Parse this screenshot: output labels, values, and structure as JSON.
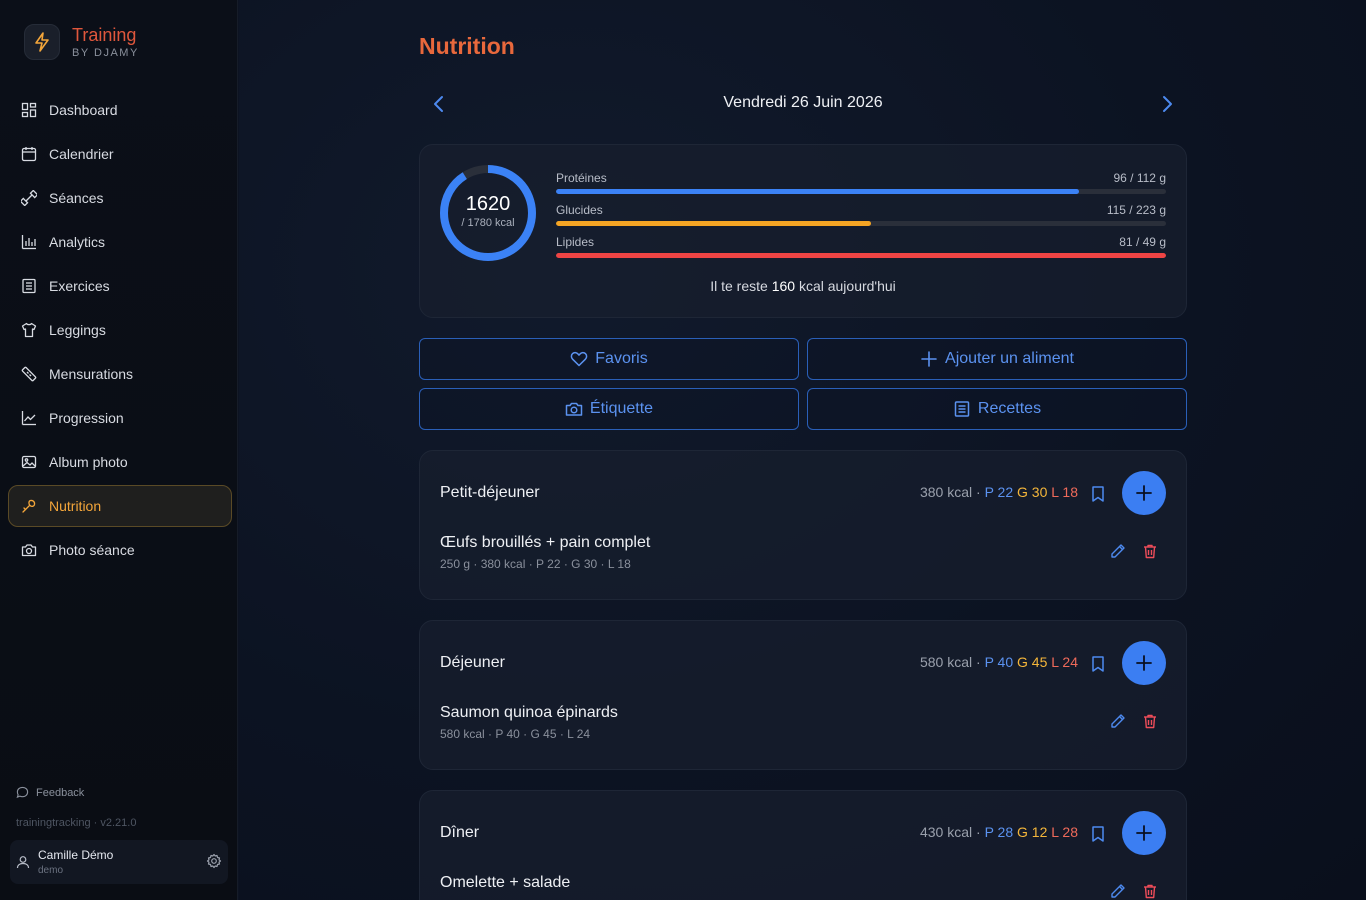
{
  "brand": {
    "title": "Training",
    "subtitle": "BY DJAMY",
    "logo_icon": "bolt-icon"
  },
  "sidebar": {
    "items": [
      {
        "label": "Dashboard",
        "icon": "dashboard-icon"
      },
      {
        "label": "Calendrier",
        "icon": "calendar-icon"
      },
      {
        "label": "Séances",
        "icon": "dumbbell-icon"
      },
      {
        "label": "Analytics",
        "icon": "bar-chart-icon"
      },
      {
        "label": "Exercices",
        "icon": "list-icon"
      },
      {
        "label": "Leggings",
        "icon": "shirt-icon"
      },
      {
        "label": "Mensurations",
        "icon": "ruler-icon"
      },
      {
        "label": "Progression",
        "icon": "trend-icon"
      },
      {
        "label": "Album photo",
        "icon": "image-icon"
      },
      {
        "label": "Nutrition",
        "icon": "nutrition-icon",
        "active": true
      },
      {
        "label": "Photo séance",
        "icon": "camera-icon"
      }
    ],
    "feedback": "Feedback",
    "version": "trainingtracking · v2.21.0",
    "user": {
      "name": "Camille Démo",
      "login": "demo"
    }
  },
  "page": {
    "title": "Nutrition",
    "date": "Vendredi 26 Juin 2026"
  },
  "summary": {
    "calories": "1620",
    "calories_goal": "/ 1780 kcal",
    "calories_fraction": 0.91,
    "macros": [
      {
        "label": "Protéines",
        "value": "96 / 112 g",
        "fraction": 0.857,
        "color": "#3b82f6"
      },
      {
        "label": "Glucides",
        "value": "115 / 223 g",
        "fraction": 0.516,
        "color": "#f5a524"
      },
      {
        "label": "Lipides",
        "value": "81 / 49 g",
        "fraction": 1.0,
        "color": "#ef4444"
      }
    ],
    "remaining_prefix": "Il te reste",
    "remaining_value": "160",
    "remaining_suffix": "kcal aujourd'hui"
  },
  "actions": {
    "favorites": "Favoris",
    "add_food": "Ajouter un aliment",
    "label_scan": "Étiquette",
    "recipes": "Recettes"
  },
  "meals": [
    {
      "name": "Petit-déjeuner",
      "kcal": "380 kcal",
      "sep": "·",
      "p": "P 22",
      "g": "G 30",
      "l": "L 18",
      "food": "Œufs brouillés + pain complet",
      "detail": "250 g · 380 kcal · P 22 · G 30 · L 18"
    },
    {
      "name": "Déjeuner",
      "kcal": "580 kcal",
      "sep": "·",
      "p": "P 40",
      "g": "G 45",
      "l": "L 24",
      "food": "Saumon quinoa épinards",
      "detail": "580 kcal · P 40 · G 45 · L 24"
    },
    {
      "name": "Dîner",
      "kcal": "430 kcal",
      "sep": "·",
      "p": "P 28",
      "g": "G 12",
      "l": "L 28",
      "food": "Omelette + salade",
      "detail": ""
    }
  ],
  "colors": {
    "accent": "#3b7ef2",
    "brand": "#e0573c",
    "active_nav": "#f4a63a"
  }
}
